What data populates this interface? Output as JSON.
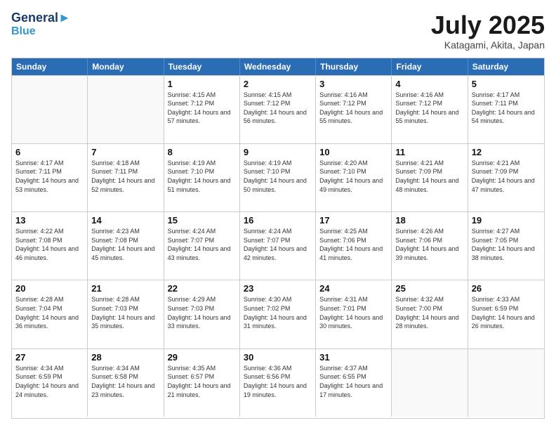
{
  "header": {
    "logo_line1": "General",
    "logo_line2": "Blue",
    "month": "July 2025",
    "location": "Katagami, Akita, Japan"
  },
  "weekdays": [
    "Sunday",
    "Monday",
    "Tuesday",
    "Wednesday",
    "Thursday",
    "Friday",
    "Saturday"
  ],
  "weeks": [
    [
      {
        "day": "",
        "sunrise": "",
        "sunset": "",
        "daylight": "",
        "empty": true
      },
      {
        "day": "",
        "sunrise": "",
        "sunset": "",
        "daylight": "",
        "empty": true
      },
      {
        "day": "1",
        "sunrise": "Sunrise: 4:15 AM",
        "sunset": "Sunset: 7:12 PM",
        "daylight": "Daylight: 14 hours and 57 minutes.",
        "empty": false
      },
      {
        "day": "2",
        "sunrise": "Sunrise: 4:15 AM",
        "sunset": "Sunset: 7:12 PM",
        "daylight": "Daylight: 14 hours and 56 minutes.",
        "empty": false
      },
      {
        "day": "3",
        "sunrise": "Sunrise: 4:16 AM",
        "sunset": "Sunset: 7:12 PM",
        "daylight": "Daylight: 14 hours and 55 minutes.",
        "empty": false
      },
      {
        "day": "4",
        "sunrise": "Sunrise: 4:16 AM",
        "sunset": "Sunset: 7:12 PM",
        "daylight": "Daylight: 14 hours and 55 minutes.",
        "empty": false
      },
      {
        "day": "5",
        "sunrise": "Sunrise: 4:17 AM",
        "sunset": "Sunset: 7:11 PM",
        "daylight": "Daylight: 14 hours and 54 minutes.",
        "empty": false
      }
    ],
    [
      {
        "day": "6",
        "sunrise": "Sunrise: 4:17 AM",
        "sunset": "Sunset: 7:11 PM",
        "daylight": "Daylight: 14 hours and 53 minutes.",
        "empty": false
      },
      {
        "day": "7",
        "sunrise": "Sunrise: 4:18 AM",
        "sunset": "Sunset: 7:11 PM",
        "daylight": "Daylight: 14 hours and 52 minutes.",
        "empty": false
      },
      {
        "day": "8",
        "sunrise": "Sunrise: 4:19 AM",
        "sunset": "Sunset: 7:10 PM",
        "daylight": "Daylight: 14 hours and 51 minutes.",
        "empty": false
      },
      {
        "day": "9",
        "sunrise": "Sunrise: 4:19 AM",
        "sunset": "Sunset: 7:10 PM",
        "daylight": "Daylight: 14 hours and 50 minutes.",
        "empty": false
      },
      {
        "day": "10",
        "sunrise": "Sunrise: 4:20 AM",
        "sunset": "Sunset: 7:10 PM",
        "daylight": "Daylight: 14 hours and 49 minutes.",
        "empty": false
      },
      {
        "day": "11",
        "sunrise": "Sunrise: 4:21 AM",
        "sunset": "Sunset: 7:09 PM",
        "daylight": "Daylight: 14 hours and 48 minutes.",
        "empty": false
      },
      {
        "day": "12",
        "sunrise": "Sunrise: 4:21 AM",
        "sunset": "Sunset: 7:09 PM",
        "daylight": "Daylight: 14 hours and 47 minutes.",
        "empty": false
      }
    ],
    [
      {
        "day": "13",
        "sunrise": "Sunrise: 4:22 AM",
        "sunset": "Sunset: 7:08 PM",
        "daylight": "Daylight: 14 hours and 46 minutes.",
        "empty": false
      },
      {
        "day": "14",
        "sunrise": "Sunrise: 4:23 AM",
        "sunset": "Sunset: 7:08 PM",
        "daylight": "Daylight: 14 hours and 45 minutes.",
        "empty": false
      },
      {
        "day": "15",
        "sunrise": "Sunrise: 4:24 AM",
        "sunset": "Sunset: 7:07 PM",
        "daylight": "Daylight: 14 hours and 43 minutes.",
        "empty": false
      },
      {
        "day": "16",
        "sunrise": "Sunrise: 4:24 AM",
        "sunset": "Sunset: 7:07 PM",
        "daylight": "Daylight: 14 hours and 42 minutes.",
        "empty": false
      },
      {
        "day": "17",
        "sunrise": "Sunrise: 4:25 AM",
        "sunset": "Sunset: 7:06 PM",
        "daylight": "Daylight: 14 hours and 41 minutes.",
        "empty": false
      },
      {
        "day": "18",
        "sunrise": "Sunrise: 4:26 AM",
        "sunset": "Sunset: 7:06 PM",
        "daylight": "Daylight: 14 hours and 39 minutes.",
        "empty": false
      },
      {
        "day": "19",
        "sunrise": "Sunrise: 4:27 AM",
        "sunset": "Sunset: 7:05 PM",
        "daylight": "Daylight: 14 hours and 38 minutes.",
        "empty": false
      }
    ],
    [
      {
        "day": "20",
        "sunrise": "Sunrise: 4:28 AM",
        "sunset": "Sunset: 7:04 PM",
        "daylight": "Daylight: 14 hours and 36 minutes.",
        "empty": false
      },
      {
        "day": "21",
        "sunrise": "Sunrise: 4:28 AM",
        "sunset": "Sunset: 7:03 PM",
        "daylight": "Daylight: 14 hours and 35 minutes.",
        "empty": false
      },
      {
        "day": "22",
        "sunrise": "Sunrise: 4:29 AM",
        "sunset": "Sunset: 7:03 PM",
        "daylight": "Daylight: 14 hours and 33 minutes.",
        "empty": false
      },
      {
        "day": "23",
        "sunrise": "Sunrise: 4:30 AM",
        "sunset": "Sunset: 7:02 PM",
        "daylight": "Daylight: 14 hours and 31 minutes.",
        "empty": false
      },
      {
        "day": "24",
        "sunrise": "Sunrise: 4:31 AM",
        "sunset": "Sunset: 7:01 PM",
        "daylight": "Daylight: 14 hours and 30 minutes.",
        "empty": false
      },
      {
        "day": "25",
        "sunrise": "Sunrise: 4:32 AM",
        "sunset": "Sunset: 7:00 PM",
        "daylight": "Daylight: 14 hours and 28 minutes.",
        "empty": false
      },
      {
        "day": "26",
        "sunrise": "Sunrise: 4:33 AM",
        "sunset": "Sunset: 6:59 PM",
        "daylight": "Daylight: 14 hours and 26 minutes.",
        "empty": false
      }
    ],
    [
      {
        "day": "27",
        "sunrise": "Sunrise: 4:34 AM",
        "sunset": "Sunset: 6:59 PM",
        "daylight": "Daylight: 14 hours and 24 minutes.",
        "empty": false
      },
      {
        "day": "28",
        "sunrise": "Sunrise: 4:34 AM",
        "sunset": "Sunset: 6:58 PM",
        "daylight": "Daylight: 14 hours and 23 minutes.",
        "empty": false
      },
      {
        "day": "29",
        "sunrise": "Sunrise: 4:35 AM",
        "sunset": "Sunset: 6:57 PM",
        "daylight": "Daylight: 14 hours and 21 minutes.",
        "empty": false
      },
      {
        "day": "30",
        "sunrise": "Sunrise: 4:36 AM",
        "sunset": "Sunset: 6:56 PM",
        "daylight": "Daylight: 14 hours and 19 minutes.",
        "empty": false
      },
      {
        "day": "31",
        "sunrise": "Sunrise: 4:37 AM",
        "sunset": "Sunset: 6:55 PM",
        "daylight": "Daylight: 14 hours and 17 minutes.",
        "empty": false
      },
      {
        "day": "",
        "sunrise": "",
        "sunset": "",
        "daylight": "",
        "empty": true
      },
      {
        "day": "",
        "sunrise": "",
        "sunset": "",
        "daylight": "",
        "empty": true
      }
    ]
  ]
}
